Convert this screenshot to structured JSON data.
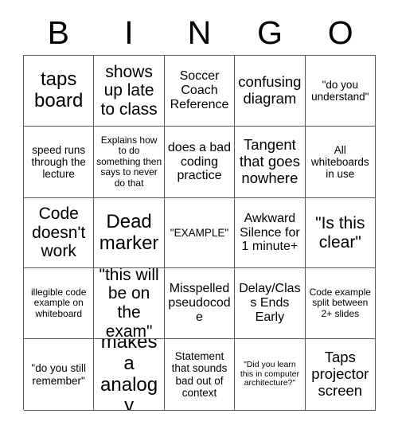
{
  "header": {
    "letters": [
      "B",
      "I",
      "N",
      "G",
      "O"
    ]
  },
  "grid": {
    "rows": [
      [
        {
          "text": "taps board",
          "size": "fs-xxl"
        },
        {
          "text": "shows up late to class",
          "size": "fs-xl"
        },
        {
          "text": "Soccer Coach Reference",
          "size": "fs-md"
        },
        {
          "text": "confusing diagram",
          "size": "fs-lg"
        },
        {
          "text": "\"do you understand\"",
          "size": "fs-sm"
        }
      ],
      [
        {
          "text": "speed runs through the lecture",
          "size": "fs-sm"
        },
        {
          "text": "Explains how to do something then says to never do that",
          "size": "fs-xs"
        },
        {
          "text": "does a bad coding practice",
          "size": "fs-md"
        },
        {
          "text": "Tangent that goes nowhere",
          "size": "fs-lg"
        },
        {
          "text": "All whiteboards in use",
          "size": "fs-sm"
        }
      ],
      [
        {
          "text": "Code doesn't work",
          "size": "fs-xl"
        },
        {
          "text": "Dead marker",
          "size": "fs-xxl"
        },
        {
          "text": "\"EXAMPLE\"",
          "size": "fs-sm"
        },
        {
          "text": "Awkward Silence for 1 minute+",
          "size": "fs-md"
        },
        {
          "text": "\"Is this clear\"",
          "size": "fs-xl"
        }
      ],
      [
        {
          "text": "illegible code example on whiteboard",
          "size": "fs-xs"
        },
        {
          "text": "\"this will be on the exam\"",
          "size": "fs-xl"
        },
        {
          "text": "Misspelled pseudocode",
          "size": "fs-md"
        },
        {
          "text": "Delay/Class Ends Early",
          "size": "fs-md"
        },
        {
          "text": "Code example split between 2+ slides",
          "size": "fs-xs"
        }
      ],
      [
        {
          "text": "\"do you still remember\"",
          "size": "fs-sm"
        },
        {
          "text": "makes a analogy",
          "size": "fs-xxl"
        },
        {
          "text": "Statement that sounds bad out of context",
          "size": "fs-sm"
        },
        {
          "text": "\"Did you learn this in computer architecture?\"",
          "size": "fs-xxs"
        },
        {
          "text": "Taps projector screen",
          "size": "fs-lg"
        }
      ]
    ]
  },
  "colors": {
    "border": "#5a5a5a",
    "text": "#000000",
    "background": "#ffffff"
  }
}
